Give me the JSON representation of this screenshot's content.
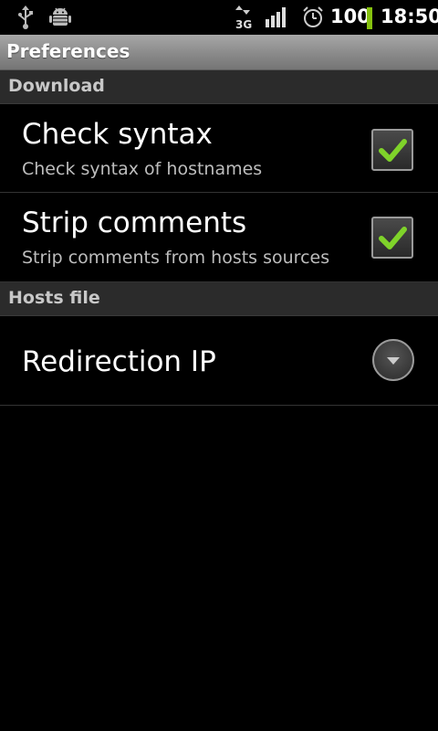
{
  "status_bar": {
    "icons": [
      "usb-icon",
      "android-debug-icon",
      "data-3g-icon",
      "signal-icon",
      "alarm-icon"
    ],
    "network_type": "3G",
    "battery": "100",
    "time": "18:50",
    "battery_color": "#86c20e"
  },
  "title_bar": {
    "title": "Preferences"
  },
  "categories": {
    "download": "Download",
    "hosts_file": "Hosts file"
  },
  "preferences": {
    "check_syntax": {
      "title": "Check syntax",
      "summary": "Check syntax of hostnames",
      "checked": true
    },
    "strip_comments": {
      "title": "Strip comments",
      "summary": "Strip comments from hosts sources",
      "checked": true
    },
    "redirection_ip": {
      "title": "Redirection IP",
      "control": "chevron-down-icon"
    }
  },
  "colors": {
    "check_mark": "#7fd32a",
    "category_background": "#2b2b2b",
    "summary_text": "#bdbdbd"
  }
}
